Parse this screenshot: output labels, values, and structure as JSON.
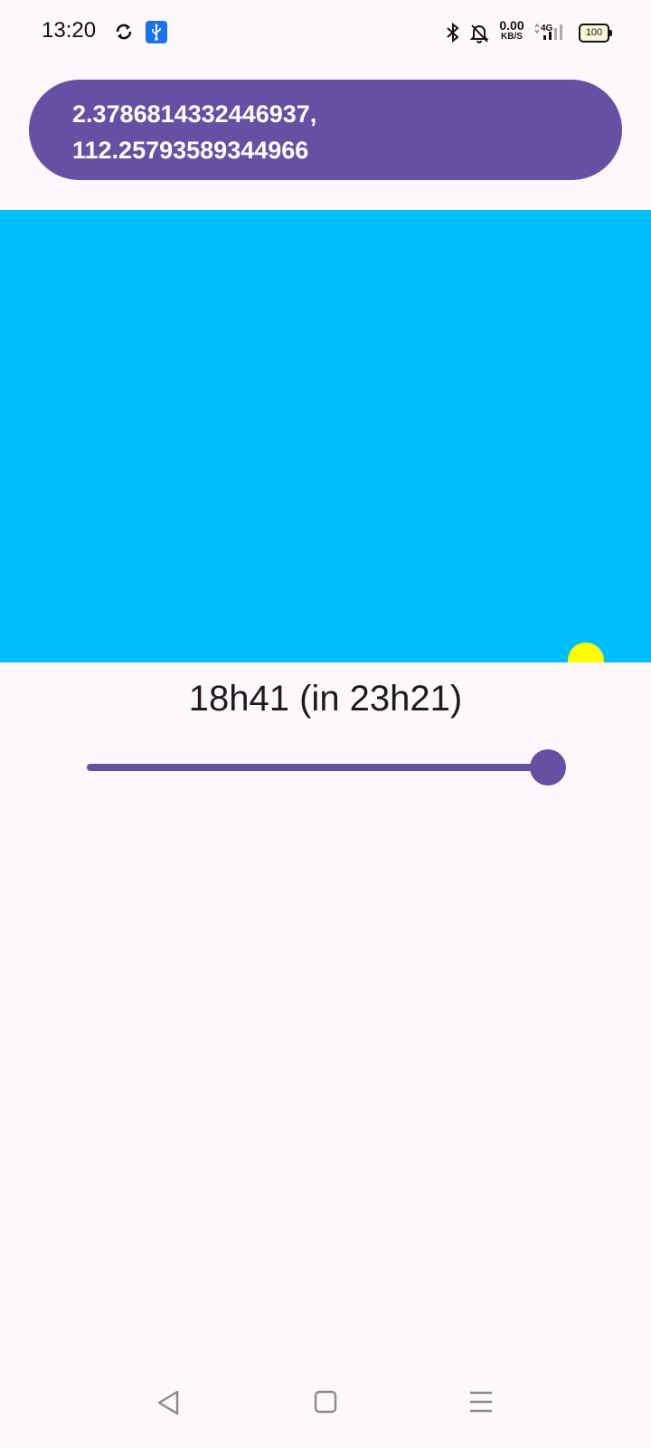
{
  "status_bar": {
    "time": "13:20",
    "net_speed_value": "0.00",
    "net_speed_unit": "KB/S",
    "network_type": "4G",
    "battery_level": "100",
    "icons": [
      "sync-icon",
      "usb-icon",
      "bluetooth-icon",
      "bell-off-icon",
      "signal-icon",
      "battery-icon"
    ]
  },
  "location": {
    "latitude": "2.3786814332446937,",
    "longitude": "112.25793589344966"
  },
  "sky": {
    "sky_color": "#00bfff",
    "sun_color": "#ffff00"
  },
  "time_display": {
    "label": "18h41 (in 23h21)"
  },
  "slider": {
    "value_fraction": 1.0,
    "accent_color": "#6750a4"
  },
  "nav_bar": {
    "icons": [
      "back-icon",
      "home-icon",
      "menu-icon"
    ]
  }
}
